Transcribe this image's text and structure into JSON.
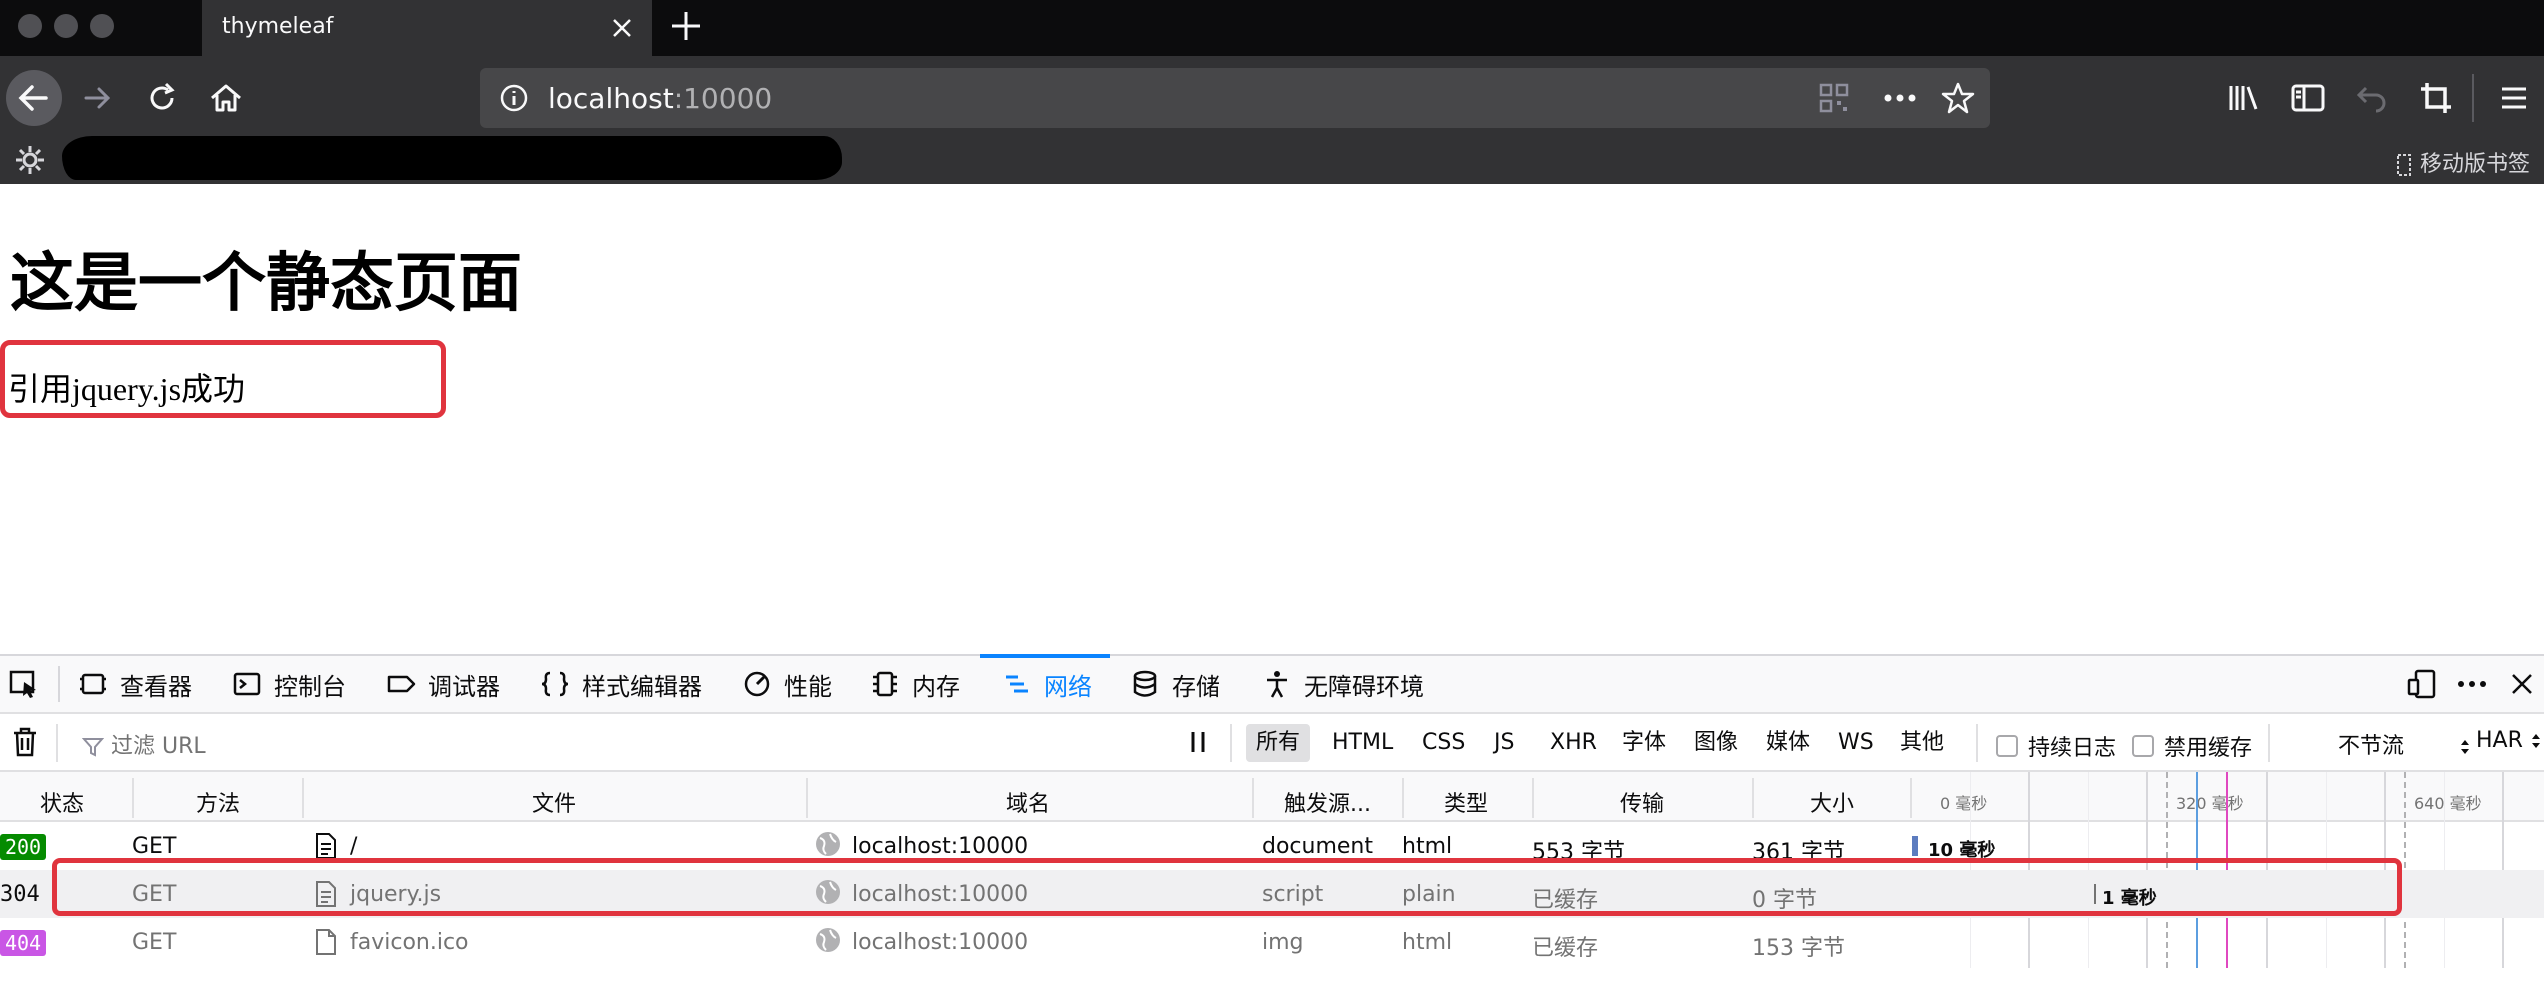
{
  "browser": {
    "tab_title": "thymeleaf",
    "url_host": "localhost",
    "url_port": ":10000",
    "mobile_bookmarks": "移动版书签"
  },
  "page": {
    "heading": "这是一个静态页面",
    "jquery_message": "引用jquery.js成功"
  },
  "devtools": {
    "tabs": [
      "查看器",
      "控制台",
      "调试器",
      "样式编辑器",
      "性能",
      "内存",
      "网络",
      "存储",
      "无障碍环境"
    ],
    "filter_placeholder": "过滤 URL",
    "types": [
      "所有",
      "HTML",
      "CSS",
      "JS",
      "XHR",
      "字体",
      "图像",
      "媒体",
      "WS",
      "其他"
    ],
    "persist_log": "持续日志",
    "disable_cache": "禁用缓存",
    "throttle": "不节流",
    "har": "HAR",
    "columns": [
      "状态",
      "方法",
      "文件",
      "域名",
      "触发源...",
      "类型",
      "传输",
      "大小"
    ],
    "timeline_ticks": [
      "0 毫秒",
      "320 毫秒",
      "640 毫秒"
    ],
    "rows": [
      {
        "status": "200",
        "method": "GET",
        "file": "/",
        "domain": "localhost:10000",
        "cause": "document",
        "type": "html",
        "transferred": "553 字节",
        "size": "361 字节",
        "timing": "10 毫秒"
      },
      {
        "status": "304",
        "method": "GET",
        "file": "jquery.js",
        "domain": "localhost:10000",
        "cause": "script",
        "type": "plain",
        "transferred": "已缓存",
        "size": "0 字节",
        "timing": "1 毫秒"
      },
      {
        "status": "404",
        "method": "GET",
        "file": "favicon.ico",
        "domain": "localhost:10000",
        "cause": "img",
        "type": "html",
        "transferred": "已缓存",
        "size": "153 字节",
        "timing": ""
      }
    ]
  },
  "colors": {
    "accent": "#0a84ff",
    "highlight": "#e0343e",
    "status_ok": "#058b00",
    "status_404": "#c956e5"
  }
}
